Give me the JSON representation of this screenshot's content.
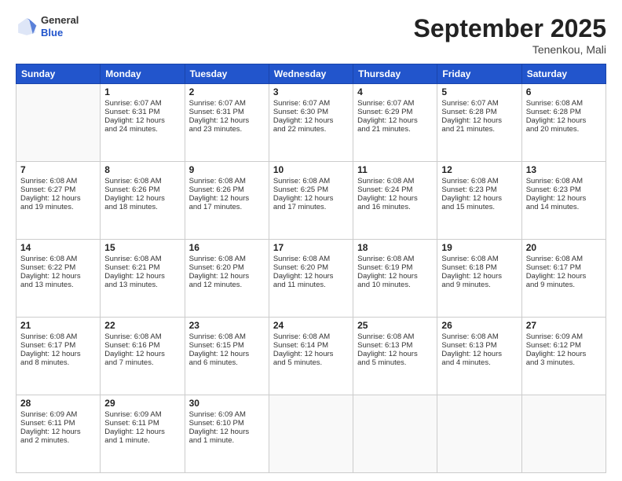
{
  "logo": {
    "general": "General",
    "blue": "Blue"
  },
  "title": "September 2025",
  "location": "Tenenkou, Mali",
  "days_header": [
    "Sunday",
    "Monday",
    "Tuesday",
    "Wednesday",
    "Thursday",
    "Friday",
    "Saturday"
  ],
  "weeks": [
    [
      {
        "day": "",
        "info": ""
      },
      {
        "day": "1",
        "info": "Sunrise: 6:07 AM\nSunset: 6:31 PM\nDaylight: 12 hours\nand 24 minutes."
      },
      {
        "day": "2",
        "info": "Sunrise: 6:07 AM\nSunset: 6:31 PM\nDaylight: 12 hours\nand 23 minutes."
      },
      {
        "day": "3",
        "info": "Sunrise: 6:07 AM\nSunset: 6:30 PM\nDaylight: 12 hours\nand 22 minutes."
      },
      {
        "day": "4",
        "info": "Sunrise: 6:07 AM\nSunset: 6:29 PM\nDaylight: 12 hours\nand 21 minutes."
      },
      {
        "day": "5",
        "info": "Sunrise: 6:07 AM\nSunset: 6:28 PM\nDaylight: 12 hours\nand 21 minutes."
      },
      {
        "day": "6",
        "info": "Sunrise: 6:08 AM\nSunset: 6:28 PM\nDaylight: 12 hours\nand 20 minutes."
      }
    ],
    [
      {
        "day": "7",
        "info": "Sunrise: 6:08 AM\nSunset: 6:27 PM\nDaylight: 12 hours\nand 19 minutes."
      },
      {
        "day": "8",
        "info": "Sunrise: 6:08 AM\nSunset: 6:26 PM\nDaylight: 12 hours\nand 18 minutes."
      },
      {
        "day": "9",
        "info": "Sunrise: 6:08 AM\nSunset: 6:26 PM\nDaylight: 12 hours\nand 17 minutes."
      },
      {
        "day": "10",
        "info": "Sunrise: 6:08 AM\nSunset: 6:25 PM\nDaylight: 12 hours\nand 17 minutes."
      },
      {
        "day": "11",
        "info": "Sunrise: 6:08 AM\nSunset: 6:24 PM\nDaylight: 12 hours\nand 16 minutes."
      },
      {
        "day": "12",
        "info": "Sunrise: 6:08 AM\nSunset: 6:23 PM\nDaylight: 12 hours\nand 15 minutes."
      },
      {
        "day": "13",
        "info": "Sunrise: 6:08 AM\nSunset: 6:23 PM\nDaylight: 12 hours\nand 14 minutes."
      }
    ],
    [
      {
        "day": "14",
        "info": "Sunrise: 6:08 AM\nSunset: 6:22 PM\nDaylight: 12 hours\nand 13 minutes."
      },
      {
        "day": "15",
        "info": "Sunrise: 6:08 AM\nSunset: 6:21 PM\nDaylight: 12 hours\nand 13 minutes."
      },
      {
        "day": "16",
        "info": "Sunrise: 6:08 AM\nSunset: 6:20 PM\nDaylight: 12 hours\nand 12 minutes."
      },
      {
        "day": "17",
        "info": "Sunrise: 6:08 AM\nSunset: 6:20 PM\nDaylight: 12 hours\nand 11 minutes."
      },
      {
        "day": "18",
        "info": "Sunrise: 6:08 AM\nSunset: 6:19 PM\nDaylight: 12 hours\nand 10 minutes."
      },
      {
        "day": "19",
        "info": "Sunrise: 6:08 AM\nSunset: 6:18 PM\nDaylight: 12 hours\nand 9 minutes."
      },
      {
        "day": "20",
        "info": "Sunrise: 6:08 AM\nSunset: 6:17 PM\nDaylight: 12 hours\nand 9 minutes."
      }
    ],
    [
      {
        "day": "21",
        "info": "Sunrise: 6:08 AM\nSunset: 6:17 PM\nDaylight: 12 hours\nand 8 minutes."
      },
      {
        "day": "22",
        "info": "Sunrise: 6:08 AM\nSunset: 6:16 PM\nDaylight: 12 hours\nand 7 minutes."
      },
      {
        "day": "23",
        "info": "Sunrise: 6:08 AM\nSunset: 6:15 PM\nDaylight: 12 hours\nand 6 minutes."
      },
      {
        "day": "24",
        "info": "Sunrise: 6:08 AM\nSunset: 6:14 PM\nDaylight: 12 hours\nand 5 minutes."
      },
      {
        "day": "25",
        "info": "Sunrise: 6:08 AM\nSunset: 6:13 PM\nDaylight: 12 hours\nand 5 minutes."
      },
      {
        "day": "26",
        "info": "Sunrise: 6:08 AM\nSunset: 6:13 PM\nDaylight: 12 hours\nand 4 minutes."
      },
      {
        "day": "27",
        "info": "Sunrise: 6:09 AM\nSunset: 6:12 PM\nDaylight: 12 hours\nand 3 minutes."
      }
    ],
    [
      {
        "day": "28",
        "info": "Sunrise: 6:09 AM\nSunset: 6:11 PM\nDaylight: 12 hours\nand 2 minutes."
      },
      {
        "day": "29",
        "info": "Sunrise: 6:09 AM\nSunset: 6:11 PM\nDaylight: 12 hours\nand 1 minute."
      },
      {
        "day": "30",
        "info": "Sunrise: 6:09 AM\nSunset: 6:10 PM\nDaylight: 12 hours\nand 1 minute."
      },
      {
        "day": "",
        "info": ""
      },
      {
        "day": "",
        "info": ""
      },
      {
        "day": "",
        "info": ""
      },
      {
        "day": "",
        "info": ""
      }
    ]
  ]
}
